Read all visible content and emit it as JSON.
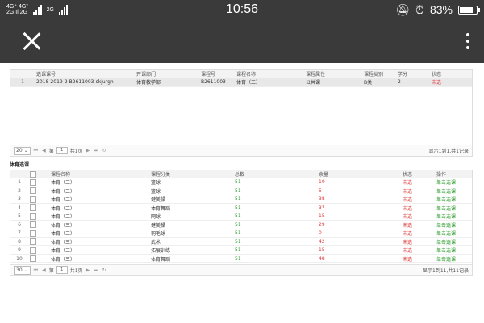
{
  "status_bar": {
    "network_top": "4G⁺ 4G²",
    "network_bottom": "2G ıl 2G",
    "signal_label": "2G",
    "time": "10:56",
    "battery": "83%",
    "battery_level": 0.83
  },
  "selected": {
    "headers": [
      "",
      "选课课号",
      "开课部门",
      "课程号",
      "课程名称",
      "课程属性",
      "课程类别",
      "学分",
      "状态"
    ],
    "rows": [
      [
        "1",
        "2018-2019-2-B2611003-skjurgh-",
        "体育教学部",
        "B2611003",
        "体育（三）",
        "公共课",
        "B类",
        "2",
        "未选"
      ]
    ],
    "pager": {
      "size": "20",
      "page_prefix": "第",
      "page": "1",
      "page_suffix": "共1页",
      "info": "显示1到1,共1记录"
    }
  },
  "pe": {
    "title": "体育选课",
    "headers": [
      "",
      "",
      "课程名称",
      "课程分类",
      "总数",
      "余量",
      "状态",
      "操作"
    ],
    "rows": [
      [
        "1",
        "体育（三）",
        "篮球",
        "51",
        "10",
        "未选",
        "单击选课"
      ],
      [
        "2",
        "体育（三）",
        "篮球",
        "51",
        "5",
        "未选",
        "单击选课"
      ],
      [
        "3",
        "体育（三）",
        "健美操",
        "51",
        "38",
        "未选",
        "单击选课"
      ],
      [
        "4",
        "体育（三）",
        "体育舞蹈",
        "51",
        "37",
        "未选",
        "单击选课"
      ],
      [
        "5",
        "体育（三）",
        "网球",
        "51",
        "15",
        "未选",
        "单击选课"
      ],
      [
        "6",
        "体育（三）",
        "健美操",
        "51",
        "29",
        "未选",
        "单击选课"
      ],
      [
        "7",
        "体育（三）",
        "羽毛球",
        "51",
        "0",
        "未选",
        "单击选课"
      ],
      [
        "8",
        "体育（三）",
        "武术",
        "51",
        "42",
        "未选",
        "单击选课"
      ],
      [
        "9",
        "体育（三）",
        "拓展训练",
        "51",
        "15",
        "未选",
        "单击选课"
      ],
      [
        "10",
        "体育（三）",
        "体育舞蹈",
        "51",
        "48",
        "未选",
        "单击选课"
      ]
    ],
    "pager": {
      "size": "30",
      "page_prefix": "第",
      "page": "1",
      "page_suffix": "共1页",
      "info": "显示1到11,共11记录"
    }
  },
  "colors": {
    "appbar": "#3a3a3a",
    "status_red": "#e03a3a",
    "action_green": "#2a9a2a"
  }
}
